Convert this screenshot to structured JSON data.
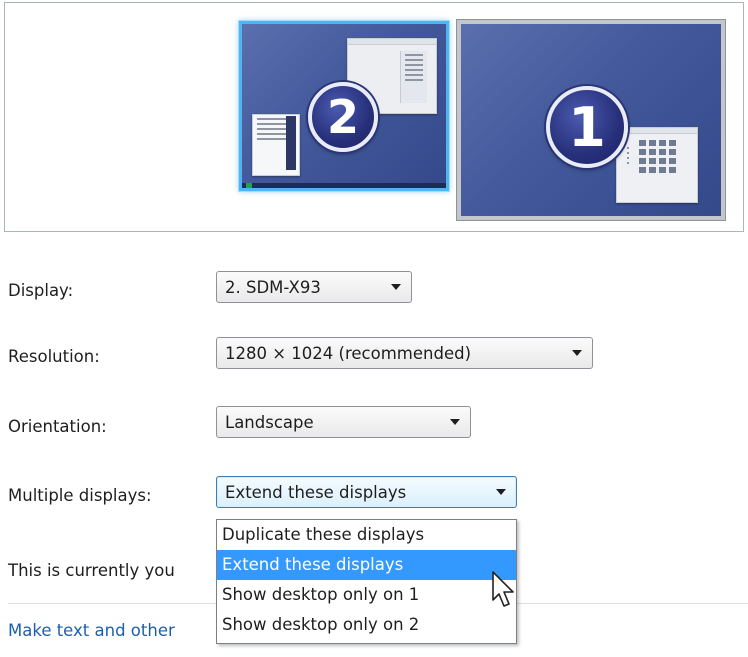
{
  "preview": {
    "monitors": [
      {
        "number": "2",
        "selected": true
      },
      {
        "number": "1",
        "selected": false
      }
    ]
  },
  "display": {
    "label": "Display:",
    "value": "2. SDM-X93"
  },
  "resolution": {
    "label": "Resolution:",
    "value": "1280 × 1024 (recommended)"
  },
  "orientation": {
    "label": "Orientation:",
    "value": "Landscape"
  },
  "multiple_displays": {
    "label": "Multiple displays:",
    "value": "Extend these displays",
    "options": [
      "Duplicate these displays",
      "Extend these displays",
      "Show desktop only on 1",
      "Show desktop only on 2"
    ]
  },
  "status_text": "This is currently you",
  "link_text": "Make text and other",
  "colors": {
    "accent": "#3399ff",
    "link": "#1b5fb0",
    "selected_border": "#4fb4f0"
  }
}
